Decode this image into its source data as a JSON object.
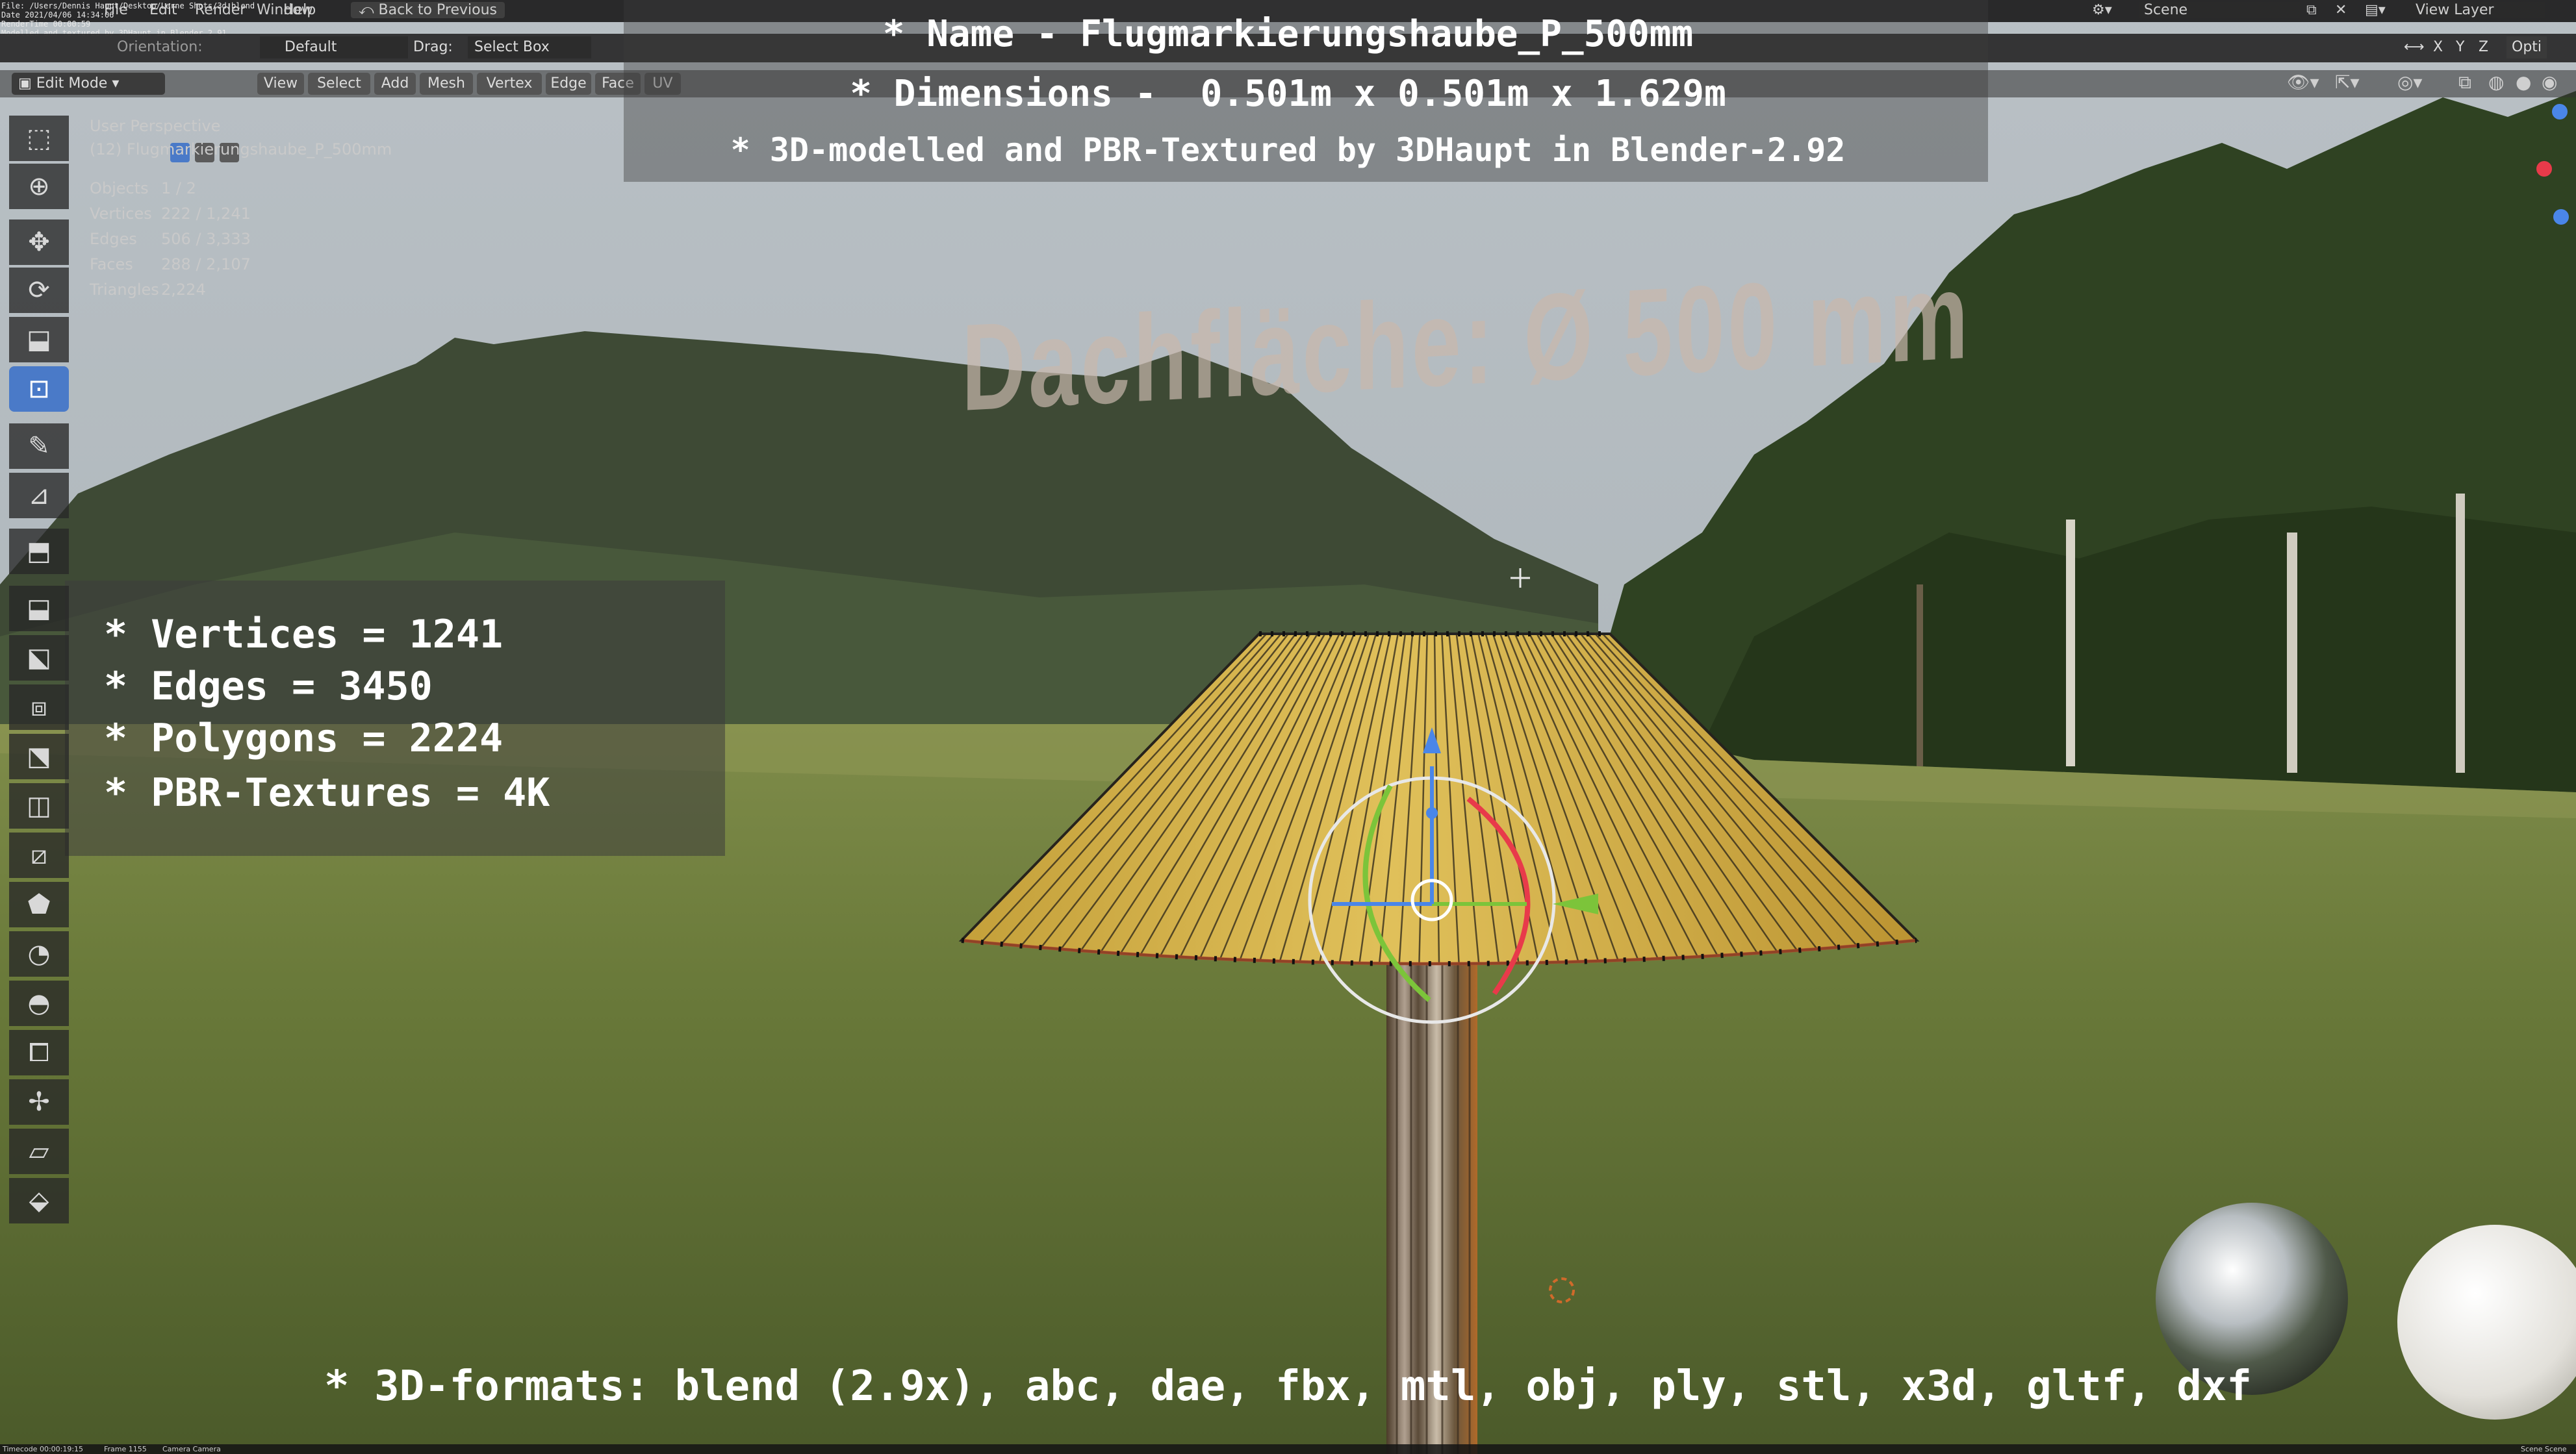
{
  "menubar": {
    "items": [
      "File",
      "Edit",
      "Render",
      "Window",
      "Help"
    ],
    "back_button": "Back to Previous",
    "scene": "Scene",
    "view_layer": "View Layer",
    "options": "Opti"
  },
  "debug_lines": [
    "File: /Users/Dennis Haupt/Desktop/Lerne Shots/3d.blend",
    "Date 2021/04/06 14:34:06",
    "RenderTime 00:00:59",
    "Modelled and textured by 3DHaupt in Blender 2.91"
  ],
  "header": {
    "orientation_label": "Orientation:",
    "orientation_value": "Default",
    "drag_label": "Drag:",
    "drag_value": "Select Box"
  },
  "toolbar": {
    "mode": "Edit Mode",
    "menus": [
      "View",
      "Select",
      "Add",
      "Mesh",
      "Vertex",
      "Edge",
      "Face",
      "UV"
    ]
  },
  "axes": [
    "X",
    "Y",
    "Z"
  ],
  "overlay_header": {
    "name": "* Name - Flugmarkierungshaube_P_500mm",
    "dimensions": "* Dimensions -  0.501m x 0.501m x 1.629m",
    "modelled": "* 3D-modelled and PBR-Textured by 3DHaupt in Blender-2.92"
  },
  "viewport": {
    "perspective": "User Perspective",
    "object_name": "(12) Flugmarkierungshaube_P_500mm",
    "stats": [
      {
        "label": "Objects",
        "value": "1 / 2"
      },
      {
        "label": "Vertices",
        "value": "222 / 1,241"
      },
      {
        "label": "Edges",
        "value": "506 / 3,333"
      },
      {
        "label": "Faces",
        "value": "288 / 2,107"
      },
      {
        "label": "Triangles",
        "value": "2,224"
      }
    ],
    "scene_text": "Dachfläche:  Ø 500 mm"
  },
  "info_box": {
    "lines": [
      "* Vertices = 1241",
      "* Edges = 3450",
      "* Polygons = 2224",
      "* PBR-Textures = 4K"
    ]
  },
  "formats_line": "* 3D-formats: blend (2.9x), abc, dae, fbx, mtl, obj, ply, stl, x3d, gltf, dxf",
  "bottom_bar": {
    "timecode": "Timecode 00:00:19:15",
    "frame": "Frame 1155",
    "camera": "Camera Camera",
    "right": "Scene Scene"
  },
  "tools": [
    "select-box-icon",
    "cursor-icon",
    "move-icon",
    "rotate-icon",
    "scale-icon",
    "transform-icon",
    "annotate-icon",
    "measure-icon",
    "add-cube-icon",
    "extrude-region-icon",
    "extrude-along-normals-icon",
    "inset-faces-icon",
    "bevel-icon",
    "loop-cut-icon",
    "knife-icon",
    "poly-build-icon",
    "spin-icon",
    "smooth-icon",
    "edge-slide-icon",
    "shrink-fatten-icon",
    "shear-icon",
    "rip-region-icon"
  ],
  "colors": {
    "accent": "#4a7ac8",
    "cone": "#d3ad43",
    "grass": "#6c7c3b",
    "sky": "#aeb6bb",
    "gizmo_red": "#e83a4a",
    "gizmo_green": "#7cc43a",
    "gizmo_blue": "#4a86e8"
  }
}
